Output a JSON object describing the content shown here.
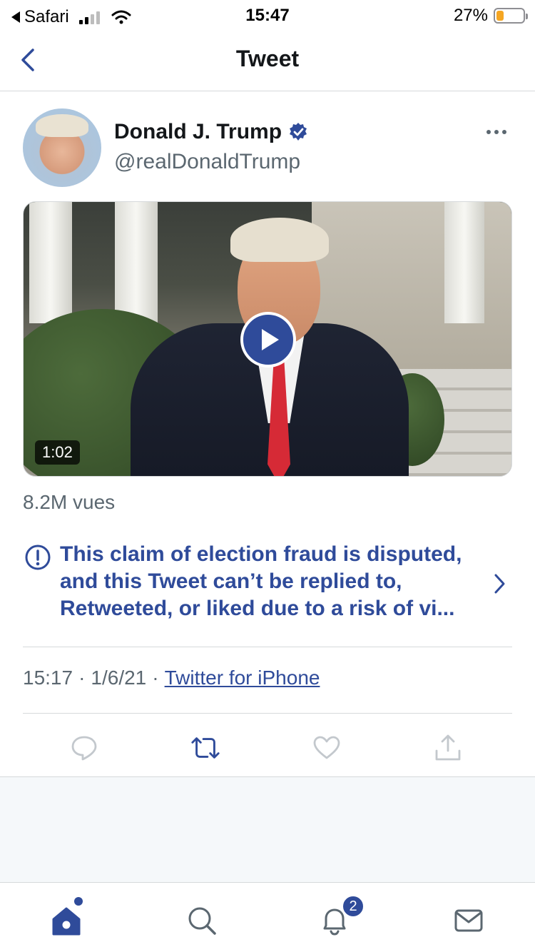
{
  "status_bar": {
    "back_app": "Safari",
    "time": "15:47",
    "battery_percent": "27%",
    "battery_level": 0.27,
    "signal_bars_active": 2,
    "signal_bars_total": 4
  },
  "nav": {
    "title": "Tweet",
    "back_icon": "chevron-left-icon"
  },
  "tweet": {
    "author_name": "Donald J. Trump",
    "verified": true,
    "handle": "@realDonaldTrump",
    "video_duration": "1:02",
    "views": "8.2M vues",
    "notice": "This claim of election fraud is disputed, and this Tweet can’t be replied to, Retweeted, or liked due to a risk of vi...",
    "time": "15:17",
    "date": "1/6/21",
    "source": "Twitter for iPhone",
    "separator": "·"
  },
  "actions": [
    {
      "name": "reply",
      "icon": "reply-icon"
    },
    {
      "name": "retweet",
      "icon": "retweet-icon"
    },
    {
      "name": "like",
      "icon": "heart-icon"
    },
    {
      "name": "share",
      "icon": "share-icon"
    }
  ],
  "tabbar": {
    "notifications_badge": "2",
    "items": [
      "home",
      "search",
      "notifications",
      "messages"
    ]
  },
  "colors": {
    "accent": "#2f4b9a",
    "text": "#14171a",
    "secondary": "#5b6770",
    "divider": "#d6d9db",
    "disabled_icon": "#c3c8cd"
  }
}
